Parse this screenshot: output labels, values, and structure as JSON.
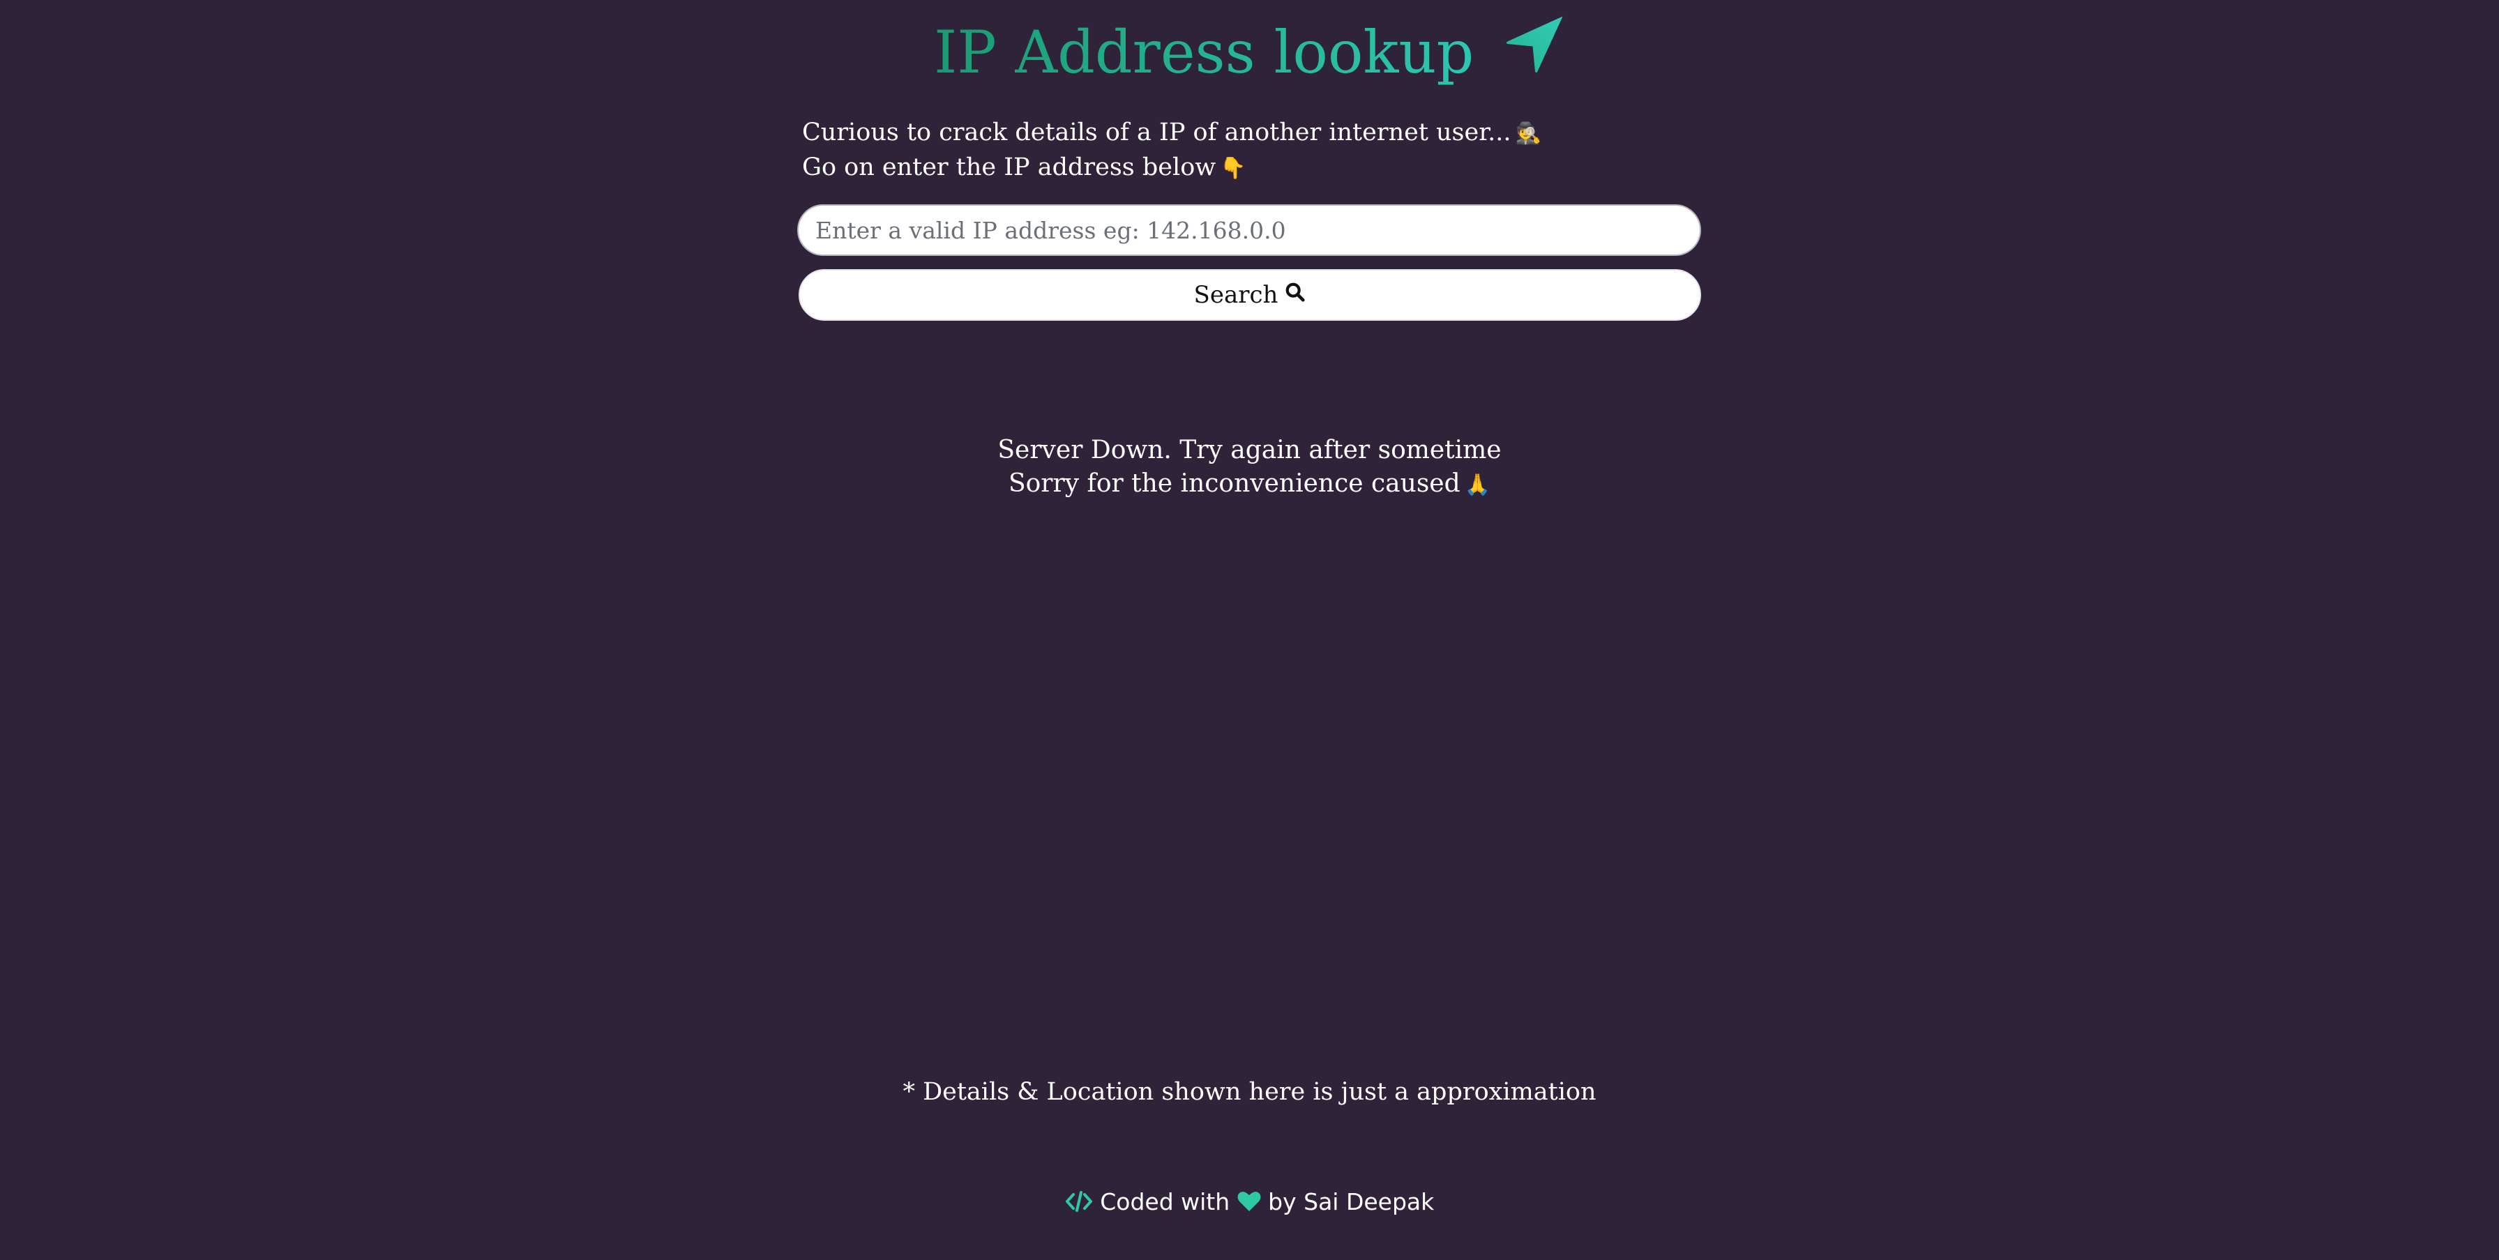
{
  "header": {
    "title": "IP Address lookup",
    "title_icon": "location-arrow-icon",
    "title_color": "#22ad88"
  },
  "intro": {
    "line1": "Curious to crack details of a IP of another internet user...",
    "line1_emoji": "🕵️",
    "line2": "Go on enter the IP address below",
    "line2_emoji": "👇"
  },
  "search": {
    "placeholder": "Enter a valid IP address eg: 142.168.0.0",
    "value": "",
    "button_label": "Search",
    "button_icon": "search-icon"
  },
  "status": {
    "line1": "Server Down. Try again after sometime",
    "line2": "Sorry for the inconvenience caused",
    "line2_emoji": "🙏"
  },
  "disclaimer": "* Details & Location shown here is just a approximation",
  "footer": {
    "prefix_icon": "code-icon",
    "text_before": "Coded with",
    "heart_icon": "heart-icon",
    "text_after": "by Sai Deepak",
    "accent_color": "#2ec9a0"
  },
  "colors": {
    "background": "#2f233a",
    "text": "#ffffff"
  }
}
